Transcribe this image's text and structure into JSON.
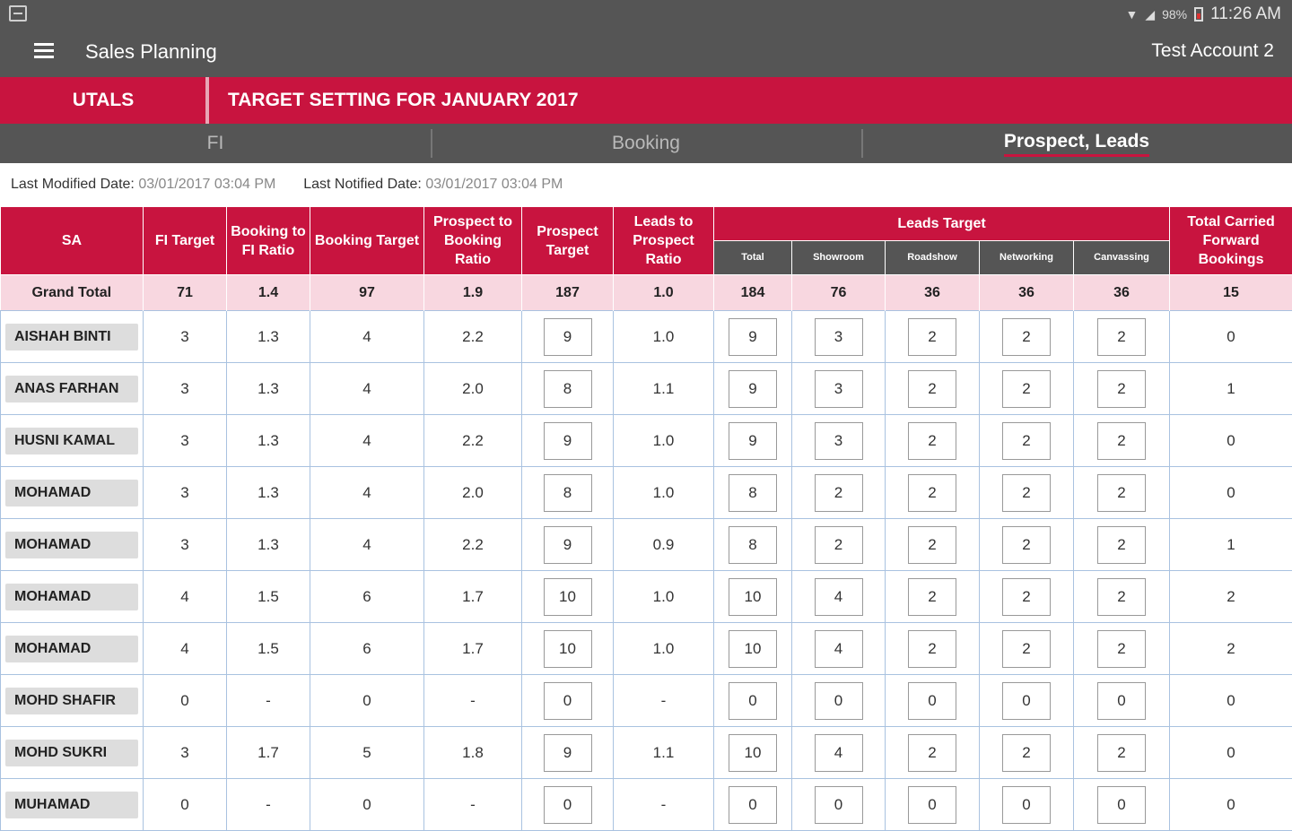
{
  "status": {
    "time": "11:26 AM",
    "battery": "98%"
  },
  "appbar": {
    "title": "Sales Planning",
    "account": "Test Account 2"
  },
  "redbar": {
    "left": "UTALS",
    "right": "TARGET SETTING FOR JANUARY 2017"
  },
  "tabs": [
    {
      "label": "FI"
    },
    {
      "label": "Booking"
    },
    {
      "label": "Prospect, Leads"
    }
  ],
  "meta": {
    "last_modified_label": "Last Modified Date:",
    "last_modified_value": "03/01/2017 03:04 PM",
    "last_notified_label": "Last Notified Date:",
    "last_notified_value": "03/01/2017 03:04 PM"
  },
  "headers": {
    "sa": "SA",
    "fi_target": "FI Target",
    "booking_to_fi_ratio": "Booking to FI Ratio",
    "booking_target": "Booking Target",
    "prospect_to_booking_ratio": "Prospect to Booking Ratio",
    "prospect_target": "Prospect Target",
    "leads_to_prospect_ratio": "Leads to Prospect Ratio",
    "leads_target": "Leads Target",
    "total_carried_forward": "Total Carried Forward Bookings",
    "sub_total": "Total",
    "sub_showroom": "Showroom",
    "sub_roadshow": "Roadshow",
    "sub_networking": "Networking",
    "sub_canvassing": "Canvassing"
  },
  "grand_total": {
    "label": "Grand Total",
    "fi_target": "71",
    "booking_to_fi_ratio": "1.4",
    "booking_target": "97",
    "prospect_to_booking_ratio": "1.9",
    "prospect_target": "187",
    "leads_to_prospect_ratio": "1.0",
    "leads_total": "184",
    "showroom": "76",
    "roadshow": "36",
    "networking": "36",
    "canvassing": "36",
    "carried_forward": "15"
  },
  "rows": [
    {
      "name": "AISHAH BINTI",
      "fi": "3",
      "bfi": "1.3",
      "bt": "4",
      "pbr": "2.2",
      "pt": "9",
      "lpr": "1.0",
      "lt": "9",
      "sr": "3",
      "rs": "2",
      "nw": "2",
      "cv": "2",
      "cf": "0"
    },
    {
      "name": "ANAS FARHAN",
      "fi": "3",
      "bfi": "1.3",
      "bt": "4",
      "pbr": "2.0",
      "pt": "8",
      "lpr": "1.1",
      "lt": "9",
      "sr": "3",
      "rs": "2",
      "nw": "2",
      "cv": "2",
      "cf": "1"
    },
    {
      "name": "HUSNI KAMAL",
      "fi": "3",
      "bfi": "1.3",
      "bt": "4",
      "pbr": "2.2",
      "pt": "9",
      "lpr": "1.0",
      "lt": "9",
      "sr": "3",
      "rs": "2",
      "nw": "2",
      "cv": "2",
      "cf": "0"
    },
    {
      "name": "MOHAMAD",
      "fi": "3",
      "bfi": "1.3",
      "bt": "4",
      "pbr": "2.0",
      "pt": "8",
      "lpr": "1.0",
      "lt": "8",
      "sr": "2",
      "rs": "2",
      "nw": "2",
      "cv": "2",
      "cf": "0"
    },
    {
      "name": "MOHAMAD",
      "fi": "3",
      "bfi": "1.3",
      "bt": "4",
      "pbr": "2.2",
      "pt": "9",
      "lpr": "0.9",
      "lt": "8",
      "sr": "2",
      "rs": "2",
      "nw": "2",
      "cv": "2",
      "cf": "1"
    },
    {
      "name": "MOHAMAD",
      "fi": "4",
      "bfi": "1.5",
      "bt": "6",
      "pbr": "1.7",
      "pt": "10",
      "lpr": "1.0",
      "lt": "10",
      "sr": "4",
      "rs": "2",
      "nw": "2",
      "cv": "2",
      "cf": "2"
    },
    {
      "name": "MOHAMAD",
      "fi": "4",
      "bfi": "1.5",
      "bt": "6",
      "pbr": "1.7",
      "pt": "10",
      "lpr": "1.0",
      "lt": "10",
      "sr": "4",
      "rs": "2",
      "nw": "2",
      "cv": "2",
      "cf": "2"
    },
    {
      "name": "MOHD SHAFIR",
      "fi": "0",
      "bfi": "-",
      "bt": "0",
      "pbr": "-",
      "pt": "0",
      "lpr": "-",
      "lt": "0",
      "sr": "0",
      "rs": "0",
      "nw": "0",
      "cv": "0",
      "cf": "0"
    },
    {
      "name": "MOHD SUKRI",
      "fi": "3",
      "bfi": "1.7",
      "bt": "5",
      "pbr": "1.8",
      "pt": "9",
      "lpr": "1.1",
      "lt": "10",
      "sr": "4",
      "rs": "2",
      "nw": "2",
      "cv": "2",
      "cf": "0"
    },
    {
      "name": "MUHAMAD",
      "fi": "0",
      "bfi": "-",
      "bt": "0",
      "pbr": "-",
      "pt": "0",
      "lpr": "-",
      "lt": "0",
      "sr": "0",
      "rs": "0",
      "nw": "0",
      "cv": "0",
      "cf": "0"
    }
  ]
}
